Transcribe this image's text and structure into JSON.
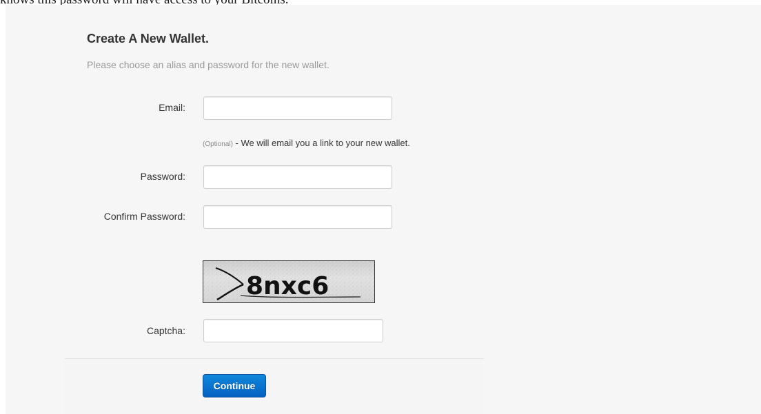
{
  "top_text": "knows this password will have access to your Bitcoins.",
  "form": {
    "title": "Create A New Wallet.",
    "subtitle": "Please choose an alias and password for the new wallet.",
    "email": {
      "label": "Email:",
      "value": "",
      "help_optional": "(Optional)",
      "help_text": " - We will email you a link to your new wallet."
    },
    "password": {
      "label": "Password:",
      "value": ""
    },
    "confirm_password": {
      "label": "Confirm Password:",
      "value": ""
    },
    "captcha": {
      "image_text": "8nxc6",
      "label": "Captcha:",
      "value": ""
    },
    "continue_label": "Continue"
  },
  "colors": {
    "panel_background": "#f6f6f6",
    "button_top": "#0e88db",
    "button_bottom": "#0560c2",
    "subtitle": "#999999"
  }
}
